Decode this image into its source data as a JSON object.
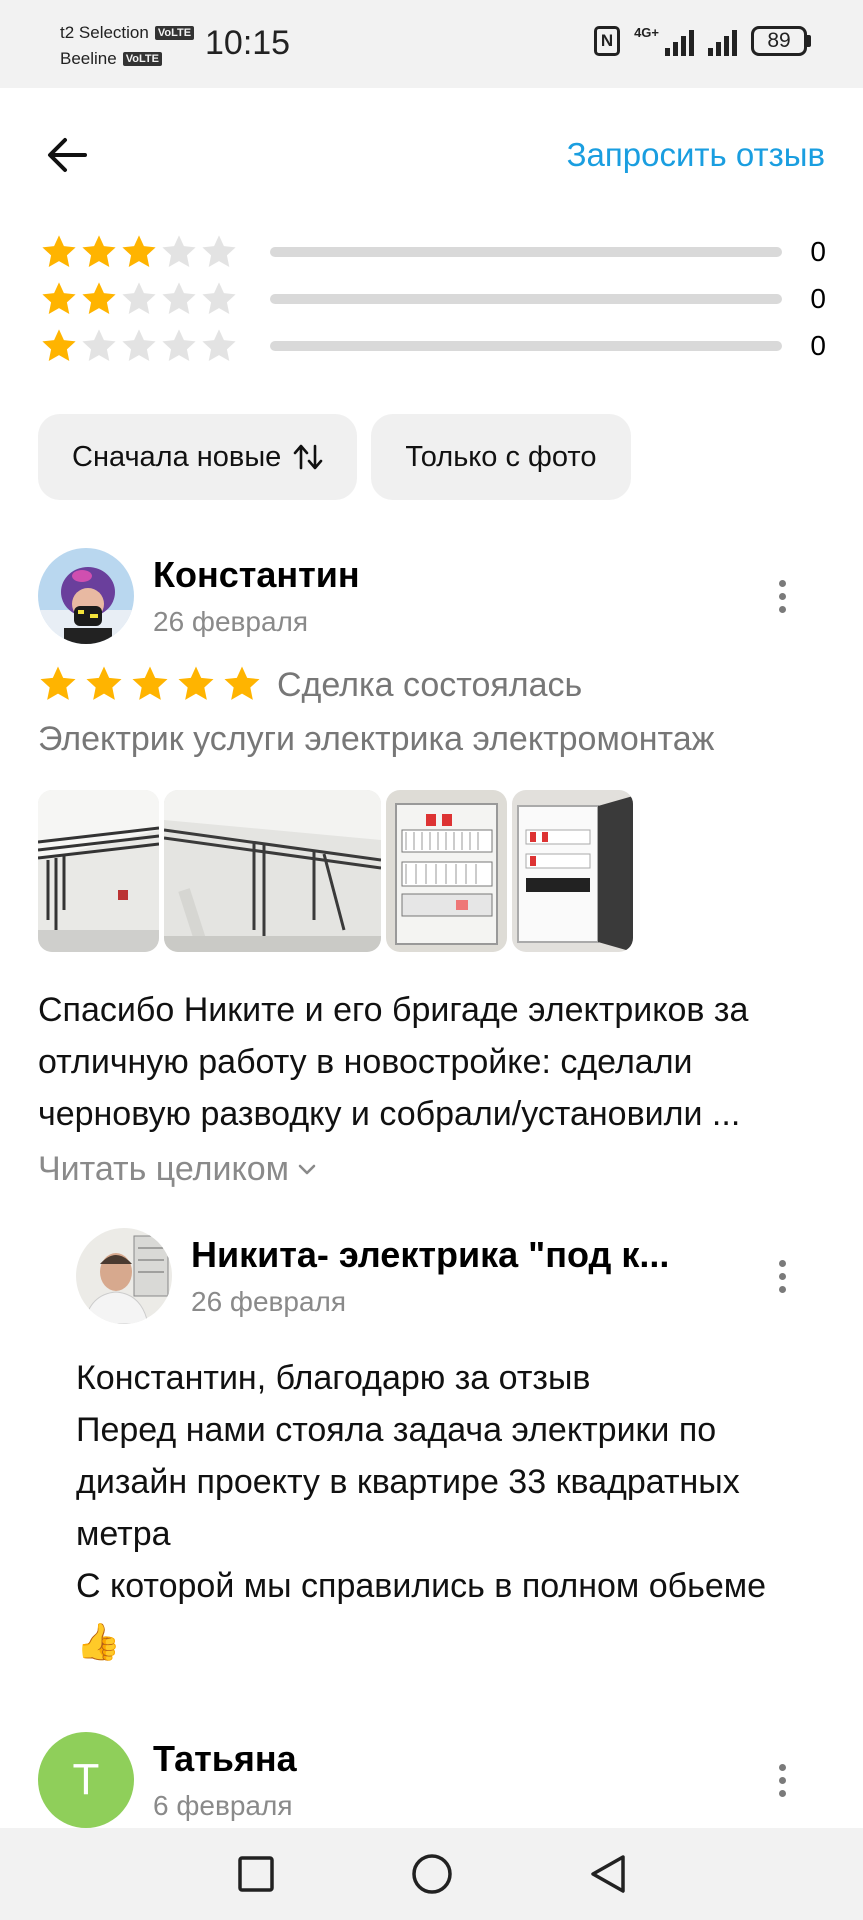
{
  "status_bar": {
    "carrier_1": "t2 Selection",
    "carrier_2": "Beeline",
    "volte": "VoLTE",
    "time": "10:15",
    "network": "4G+",
    "battery": "89"
  },
  "header": {
    "back_icon": "arrow-left-icon",
    "request_review": "Запросить отзыв"
  },
  "rating_rows": [
    {
      "stars": 3,
      "count": "0",
      "fill_fraction": 0
    },
    {
      "stars": 2,
      "count": "0",
      "fill_fraction": 0
    },
    {
      "stars": 1,
      "count": "0",
      "fill_fraction": 0
    }
  ],
  "filters": {
    "sort_label": "Сначала новые",
    "photo_label": "Только с фото"
  },
  "review": {
    "author": "Константин",
    "date": "26 февраля",
    "stars": 5,
    "deal_status": "Сделка состоялась",
    "service": "Электрик услуги электрика электромонтаж",
    "text": "Спасибо Никите и его бригаде электриков за отличную работу в новостройке: сделали черновую разводку и собрали/установили ...",
    "read_more": "Читать целиком"
  },
  "reply": {
    "author": "Никита- электрика \"под к...",
    "date": "26 февраля",
    "lines": [
      "Константин, благодарю за отзыв",
      "Перед нами стояла задача электрики по дизайн проекту в квартире 33 квадратных метра",
      "С которой мы справились в полном обьеме"
    ],
    "emoji": "👍"
  },
  "next_review": {
    "avatar_letter": "Т",
    "author": "Татьяна",
    "date": "6 февраля"
  },
  "colors": {
    "accent": "#1a9ee0",
    "star": "#ffb400",
    "star_empty": "#e3e3e3"
  }
}
